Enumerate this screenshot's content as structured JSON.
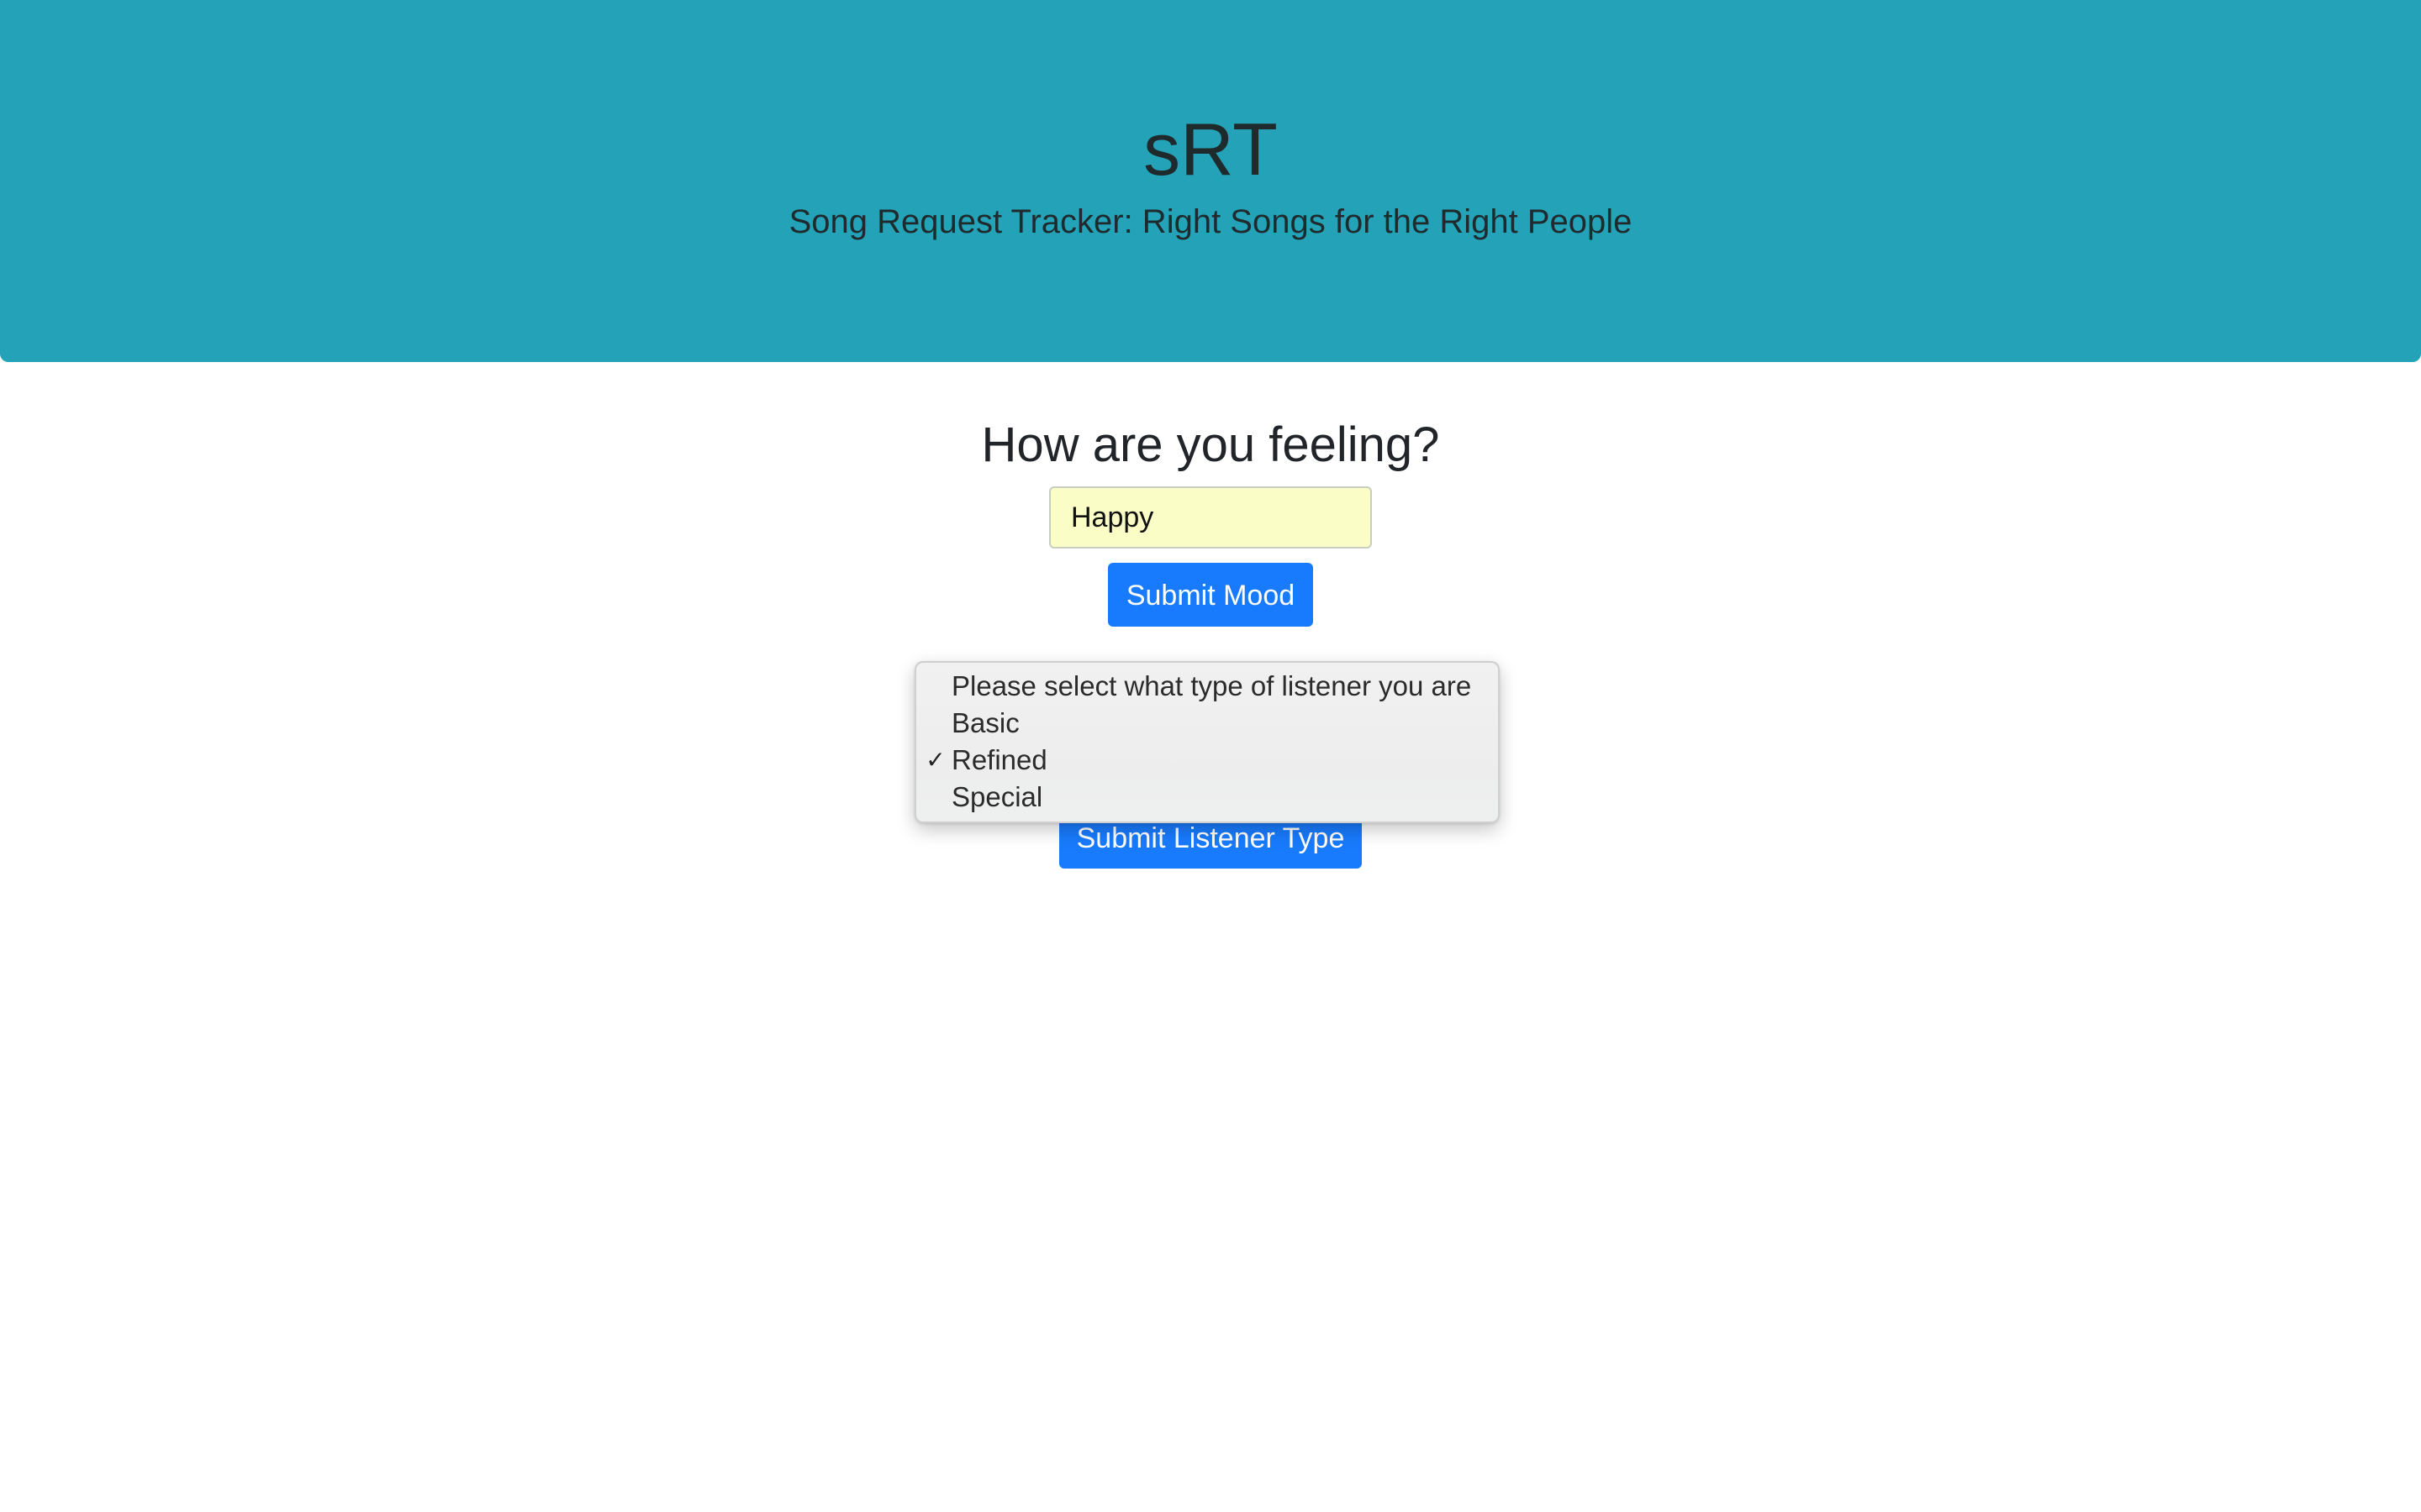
{
  "header": {
    "title": "sRT",
    "subtitle": "Song Request Tracker: Right Songs for the Right People"
  },
  "mood": {
    "heading": "How are you feeling?",
    "input_value": "Happy",
    "submit_label": "Submit Mood"
  },
  "listener": {
    "options": [
      "Please select what type of listener you are",
      "Basic",
      "Refined",
      "Special"
    ],
    "selected": "Refined",
    "submit_label": "Submit Listener Type"
  },
  "colors": {
    "header_bg": "#24a2b8",
    "button_primary": "#187bfd",
    "input_bg": "#fafdc5"
  },
  "icons": {
    "selected_marker": "checkmark-icon"
  }
}
